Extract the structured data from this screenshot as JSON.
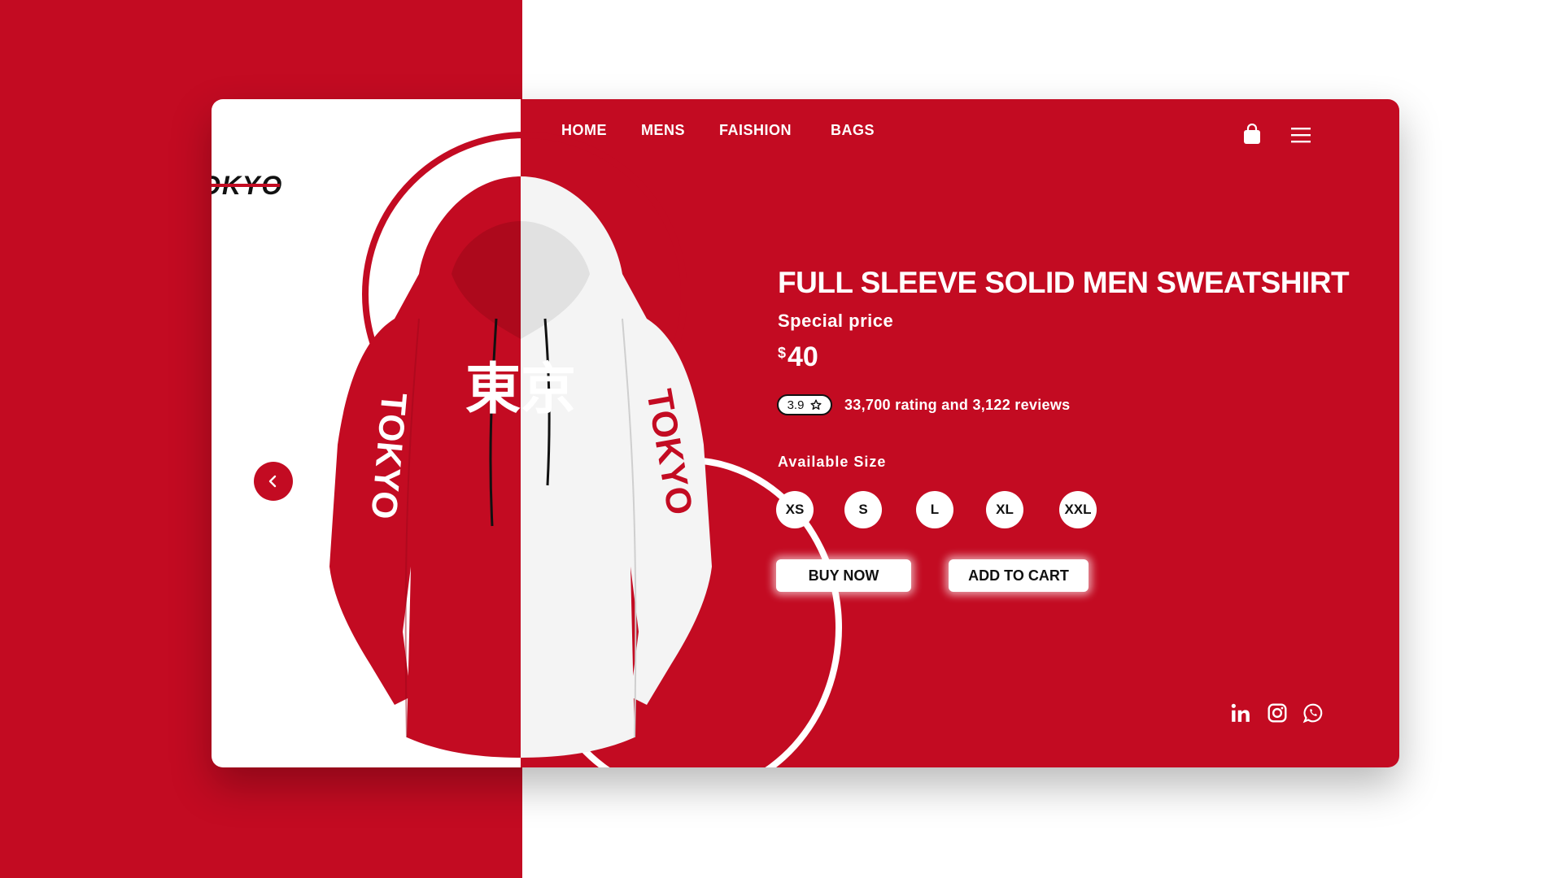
{
  "brand": {
    "logo_text": "OKYO"
  },
  "nav": {
    "items": [
      {
        "label": "HOME"
      },
      {
        "label": "MENS"
      },
      {
        "label": "FAISHION"
      },
      {
        "label": "BAGS"
      }
    ]
  },
  "product": {
    "title": "FULL SLEEVE SOLID MEN SWEATSHIRT",
    "special_label": "Special price",
    "currency": "$",
    "price": "40",
    "rating": "3.9",
    "rating_text": "33,700 rating and 3,122 reviews",
    "available_label": "Available Size",
    "sizes": [
      "XS",
      "S",
      "L",
      "XL",
      "XXL"
    ],
    "buy_label": "BUY NOW",
    "cart_label": "ADD TO CART",
    "graphic_text_left": "TOKYO",
    "graphic_text_center": "東京",
    "graphic_text_right": "TOKYO"
  },
  "icons": {
    "bag": "shopping-bag-icon",
    "menu": "hamburger-menu-icon",
    "prev": "chevron-left-icon",
    "social": [
      "linkedin-icon",
      "instagram-icon",
      "whatsapp-icon"
    ]
  },
  "colors": {
    "primary": "#c30b22",
    "white": "#ffffff",
    "dark": "#111111"
  }
}
